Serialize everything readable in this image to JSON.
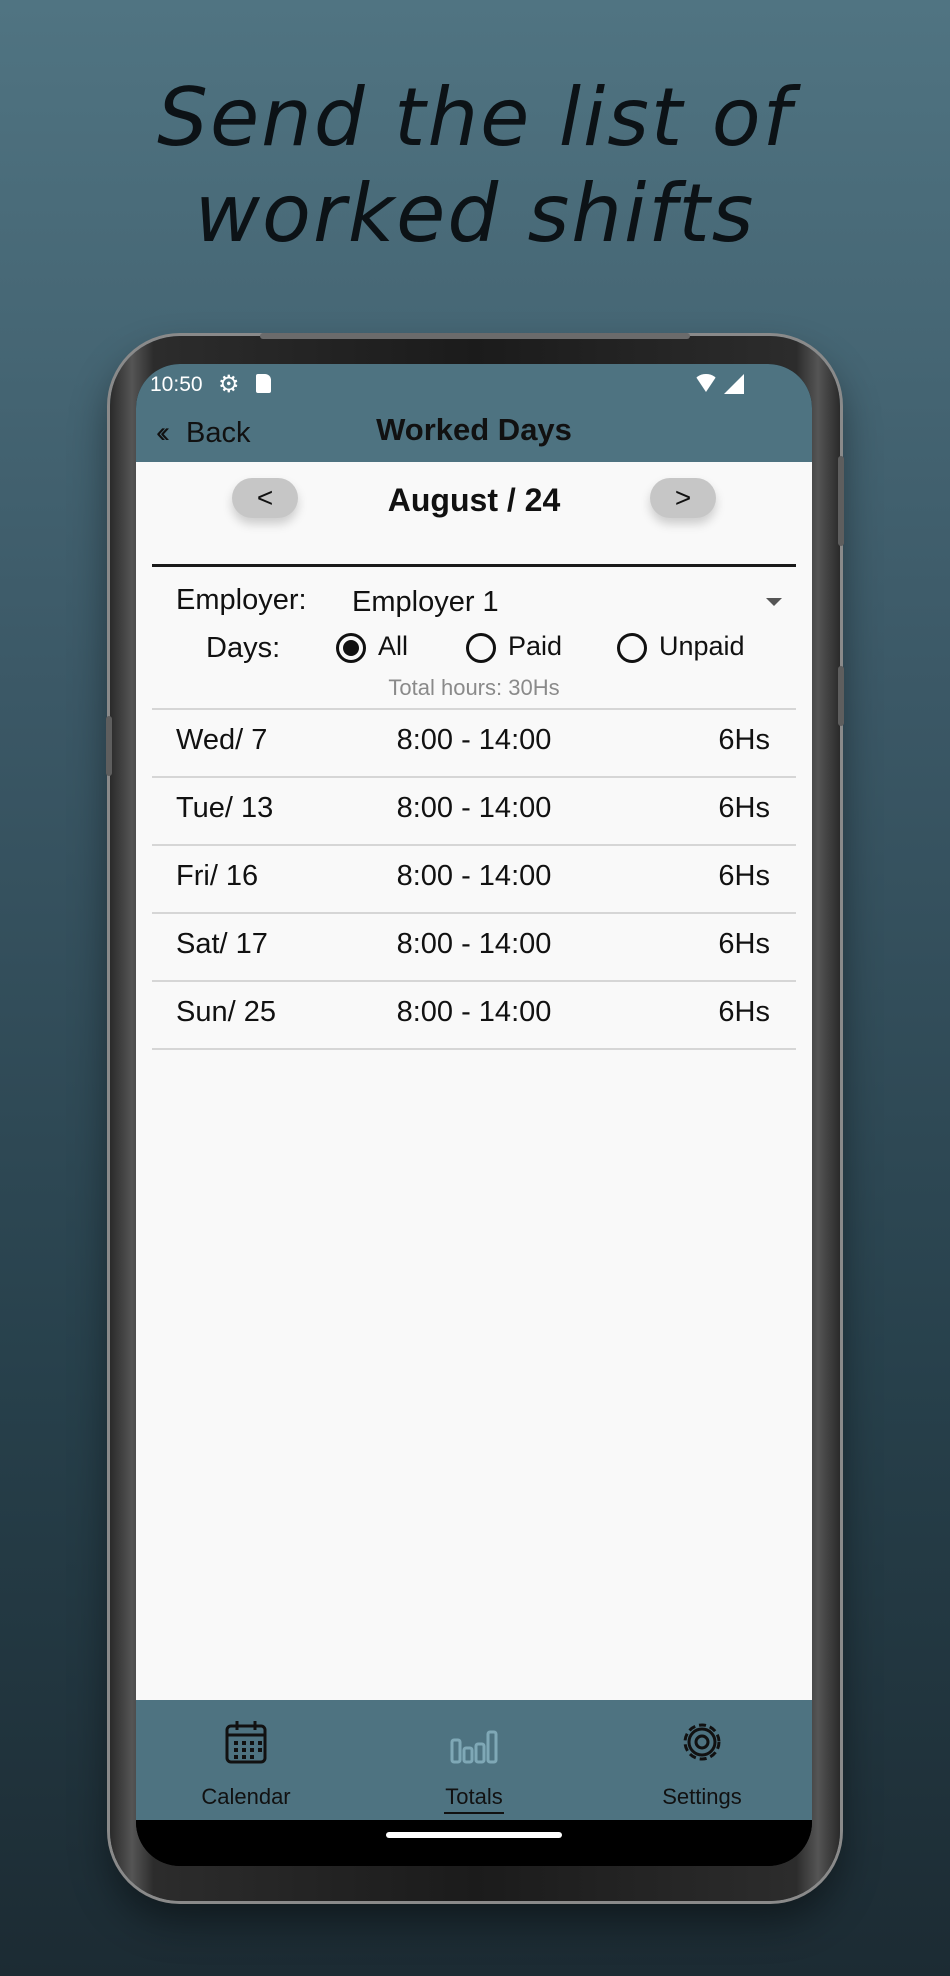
{
  "headline": {
    "line1": "Send the list of",
    "line2": "worked shifts"
  },
  "status_bar": {
    "time": "10:50",
    "icons": [
      "gear-icon",
      "sd-card-icon",
      "wifi-icon",
      "signal-icon"
    ]
  },
  "app_bar": {
    "back_label": "Back",
    "title": "Worked Days"
  },
  "month_nav": {
    "prev_glyph": "<",
    "next_glyph": ">",
    "label": "August / 24"
  },
  "filters": {
    "employer_label": "Employer:",
    "employer_value": "Employer 1",
    "days_label": "Days:",
    "options": [
      "All",
      "Paid",
      "Unpaid"
    ],
    "selected": "All",
    "total_hours": "Total hours: 30Hs"
  },
  "shifts": [
    {
      "day": "Wed/ 7",
      "time": "8:00 - 14:00",
      "hours": "6Hs"
    },
    {
      "day": "Tue/ 13",
      "time": "8:00 - 14:00",
      "hours": "6Hs"
    },
    {
      "day": "Fri/ 16",
      "time": "8:00 - 14:00",
      "hours": "6Hs"
    },
    {
      "day": "Sat/ 17",
      "time": "8:00 - 14:00",
      "hours": "6Hs"
    },
    {
      "day": "Sun/ 25",
      "time": "8:00 - 14:00",
      "hours": "6Hs"
    }
  ],
  "bottom_nav": {
    "items": [
      {
        "label": "Calendar",
        "icon": "calendar-icon"
      },
      {
        "label": "Totals",
        "icon": "bar-chart-icon",
        "active": true
      },
      {
        "label": "Settings",
        "icon": "gear-icon"
      }
    ]
  },
  "colors": {
    "bar": "#4e7381",
    "content_bg": "#f9f9f9",
    "active_icon": "#7fa8b6"
  }
}
